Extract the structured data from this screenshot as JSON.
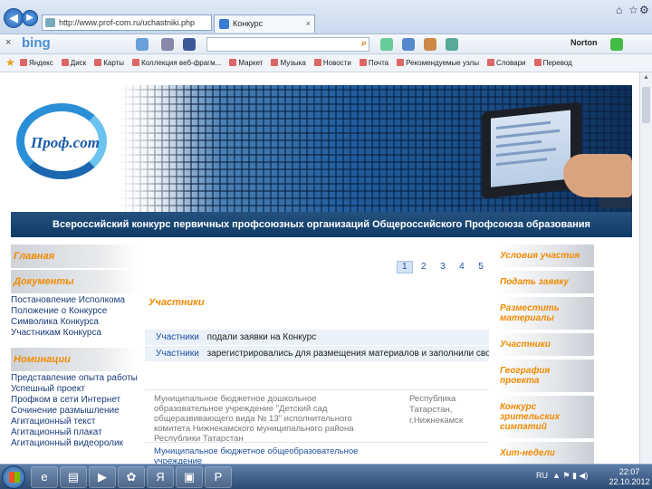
{
  "browser": {
    "address": "http://www.prof-com.ru/uchastniki.php",
    "tab_title": "Конкурс",
    "tab_close": "×",
    "bing_close": "×",
    "bing_logo": "bing",
    "norton": "Norton",
    "favorites": [
      "Яндекс",
      "Диск",
      "Карты",
      "Коллекция веб-фрагм...",
      "Маркет",
      "Музыка",
      "Новости",
      "Почта",
      "Рекомендуемые узлы",
      "Словари",
      "Перевод"
    ]
  },
  "site": {
    "logo": "Проф.com",
    "banner_title": "Всероссийский конкурс первичных профсоюзных организаций Общероссийского Профсоюза образования",
    "left": {
      "home": "Главная",
      "documents_head": "Документы",
      "documents": [
        "Постановление Исполкома",
        "Положение о Конкурсе",
        "Символика Конкурса",
        "Участникам Конкурса"
      ],
      "nominations_head": "Номинации",
      "nominations": [
        "Представление опыта работы",
        "Успешный проект",
        "Профком в сети Интернет",
        "Сочинение размышление",
        "Агитационный текст",
        "Агитационный плакат",
        "Агитационный видеоролик"
      ]
    },
    "right": [
      "Условия участия",
      "Подать заявку",
      "Разместить материалы",
      "Участники",
      "География проекта",
      "Конкурс зрительских симпатий",
      "Хит-недели"
    ],
    "main": {
      "pages": [
        "1",
        "2",
        "3",
        "4",
        "5"
      ],
      "title": "Участники",
      "filters": [
        {
          "link": "Участники",
          "text": "подали заявки на Конкурс"
        },
        {
          "link": "Участники",
          "text": "зарегистрировались для размещения материалов и заполнили свой профиль"
        }
      ],
      "entries": [
        {
          "org": "Муниципальное бюджетное дошкольное образовательное учреждение \"Детский сад общеразвивающего вида № 13\" исполнительного комитета Нижнекамского муниципального района Республики Татарстан",
          "region": "Республика Татарстан, г.Нижнекамск"
        },
        {
          "org": "Муниципальное бюджетное общеобразовательное учреждение",
          "region": ""
        }
      ]
    }
  },
  "taskbar": {
    "lang": "RU",
    "time": "22:07",
    "date": "22.10.2012"
  }
}
